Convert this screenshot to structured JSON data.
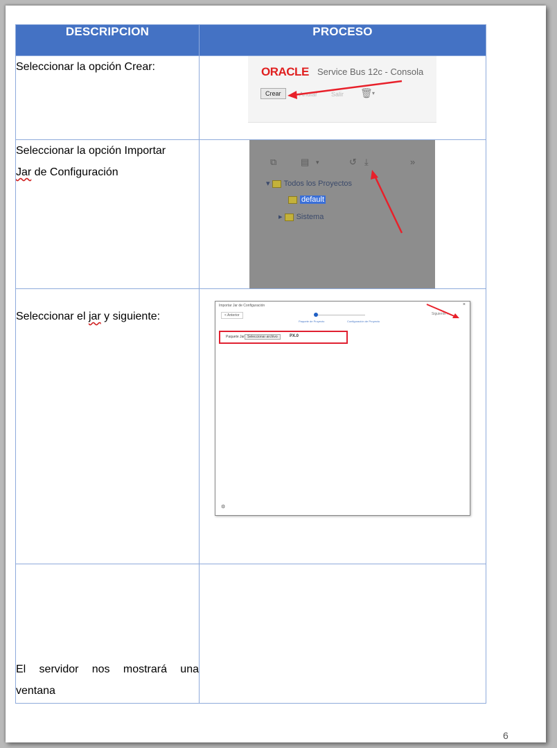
{
  "table": {
    "headers": {
      "description": "DESCRIPCION",
      "process": "PROCESO"
    },
    "rows": [
      {
        "description": "Seleccionar la opción Crear:"
      },
      {
        "description_part1": "Seleccionar la opción Importar ",
        "description_mark": "Jar",
        "description_part2": " de Configuración"
      },
      {
        "description_part1": "Seleccionar el ",
        "description_mark": "jar",
        "description_part2": " y siguiente:"
      },
      {
        "description": "El servidor nos mostrará una ventana"
      }
    ]
  },
  "screenshot_crear": {
    "brand": "ORACLE",
    "subtitle": "Service Bus 12c - Consola",
    "button": "Crear",
    "faint_labels": [
      "Anular",
      "Salir"
    ]
  },
  "screenshot_import": {
    "tree_root": "Todos los Proyectos",
    "tree_child_selected": "default",
    "tree_child2": "Sistema"
  },
  "screenshot_jar": {
    "window_title": "Importar Jar de Configuración",
    "back_button": "< Anterior",
    "step1": "Paquete de Proyecto",
    "step2": "Configuración de Proyecto",
    "next_button": "Siguiente >",
    "file_label": "Paquete Jar",
    "file_button": "Seleccionar archivo",
    "file_name": "PX.0"
  },
  "page_number": "6",
  "colors": {
    "header_bg": "#4472c4",
    "table_border": "#8eaadb",
    "oracle_red": "#e02020",
    "arrow_red": "#e8202a"
  }
}
